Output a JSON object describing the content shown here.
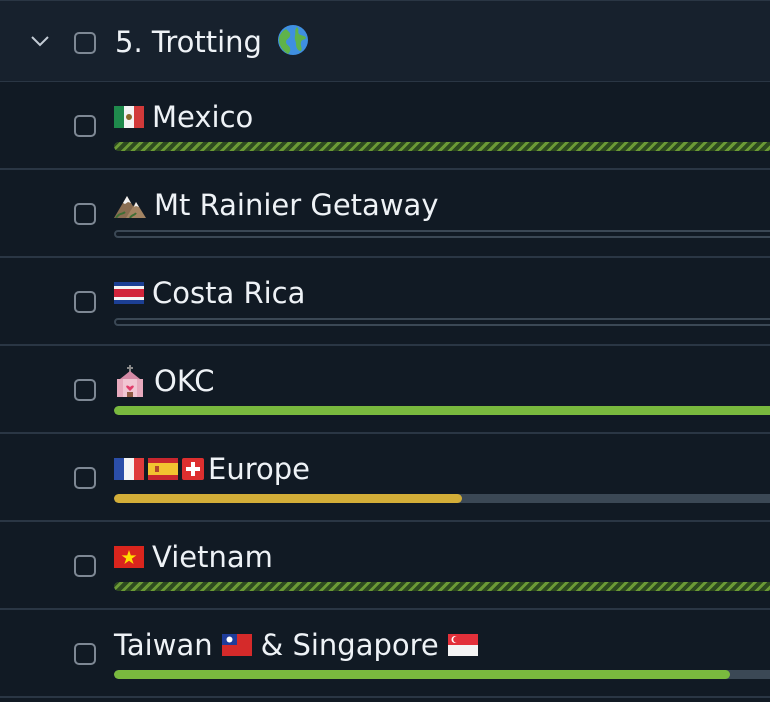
{
  "group": {
    "title": "5. Trotting",
    "icon": "globe-americas-icon"
  },
  "rows": [
    {
      "title": "Mexico",
      "icon": "mexico-flag-icon",
      "progress": 1.0,
      "style": "striped"
    },
    {
      "title": "Mt Rainier Getaway",
      "icon": "mountain-icon",
      "progress": 0.0,
      "style": "empty"
    },
    {
      "title": "Costa Rica",
      "icon": "costa-rica-flag-icon",
      "progress": 0.0,
      "style": "empty"
    },
    {
      "title": "OKC",
      "icon": "wedding-chapel-icon",
      "progress": 1.0,
      "style": "green"
    },
    {
      "title": "Europe",
      "icons": [
        "france-flag-icon",
        "spain-flag-icon",
        "switzerland-flag-icon"
      ],
      "progress": 0.52,
      "style": "yellow"
    },
    {
      "title": "Vietnam",
      "icon": "vietnam-flag-icon",
      "progress": 1.0,
      "style": "striped"
    },
    {
      "title_parts": [
        "Taiwan",
        "& Singapore"
      ],
      "icons": [
        "taiwan-flag-icon",
        "singapore-flag-icon"
      ],
      "progress": 0.92,
      "style": "green"
    }
  ],
  "colors": {
    "background": "#111a24",
    "header_background": "#17212d",
    "divider": "#2a3644",
    "track": "#3b4855",
    "green": "#79b93e",
    "yellow": "#d3ae38",
    "text": "#eef2f6"
  }
}
